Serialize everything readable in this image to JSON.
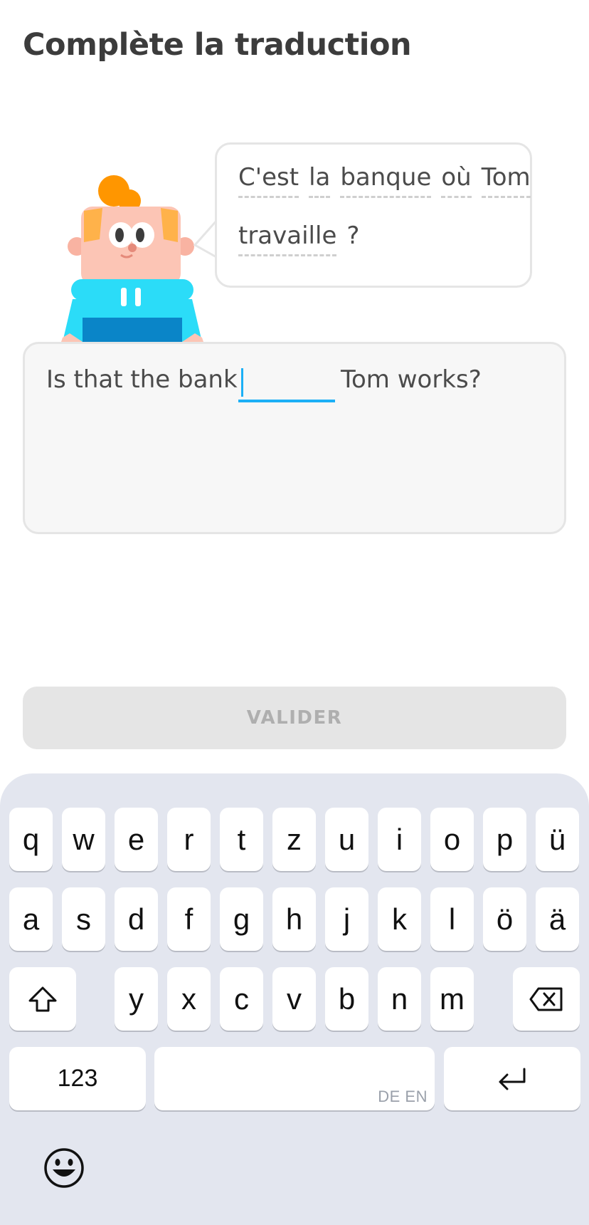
{
  "header": {
    "title": "Complète la traduction"
  },
  "prompt": {
    "line1": [
      "C'est",
      "la",
      "banque",
      "où",
      "Tom"
    ],
    "line2_word": "travaille",
    "line2_punct": "?"
  },
  "answer": {
    "before_blank": "Is that the bank",
    "after_blank": "Tom works?",
    "blank_value": ""
  },
  "validate_label": "VALIDER",
  "keyboard": {
    "row1": [
      "q",
      "w",
      "e",
      "r",
      "t",
      "z",
      "u",
      "i",
      "o",
      "p",
      "ü"
    ],
    "row2": [
      "a",
      "s",
      "d",
      "f",
      "g",
      "h",
      "j",
      "k",
      "l",
      "ö",
      "ä"
    ],
    "row3": [
      "y",
      "x",
      "c",
      "v",
      "b",
      "n",
      "m"
    ],
    "numbers_label": "123",
    "space_hint": "DE EN"
  },
  "colors": {
    "accent": "#1cb0f6",
    "title": "#3c3c3c",
    "disabled_button": "#e5e5e5"
  },
  "icons": [
    "shift-icon",
    "backspace-icon",
    "return-icon",
    "emoji-icon"
  ]
}
